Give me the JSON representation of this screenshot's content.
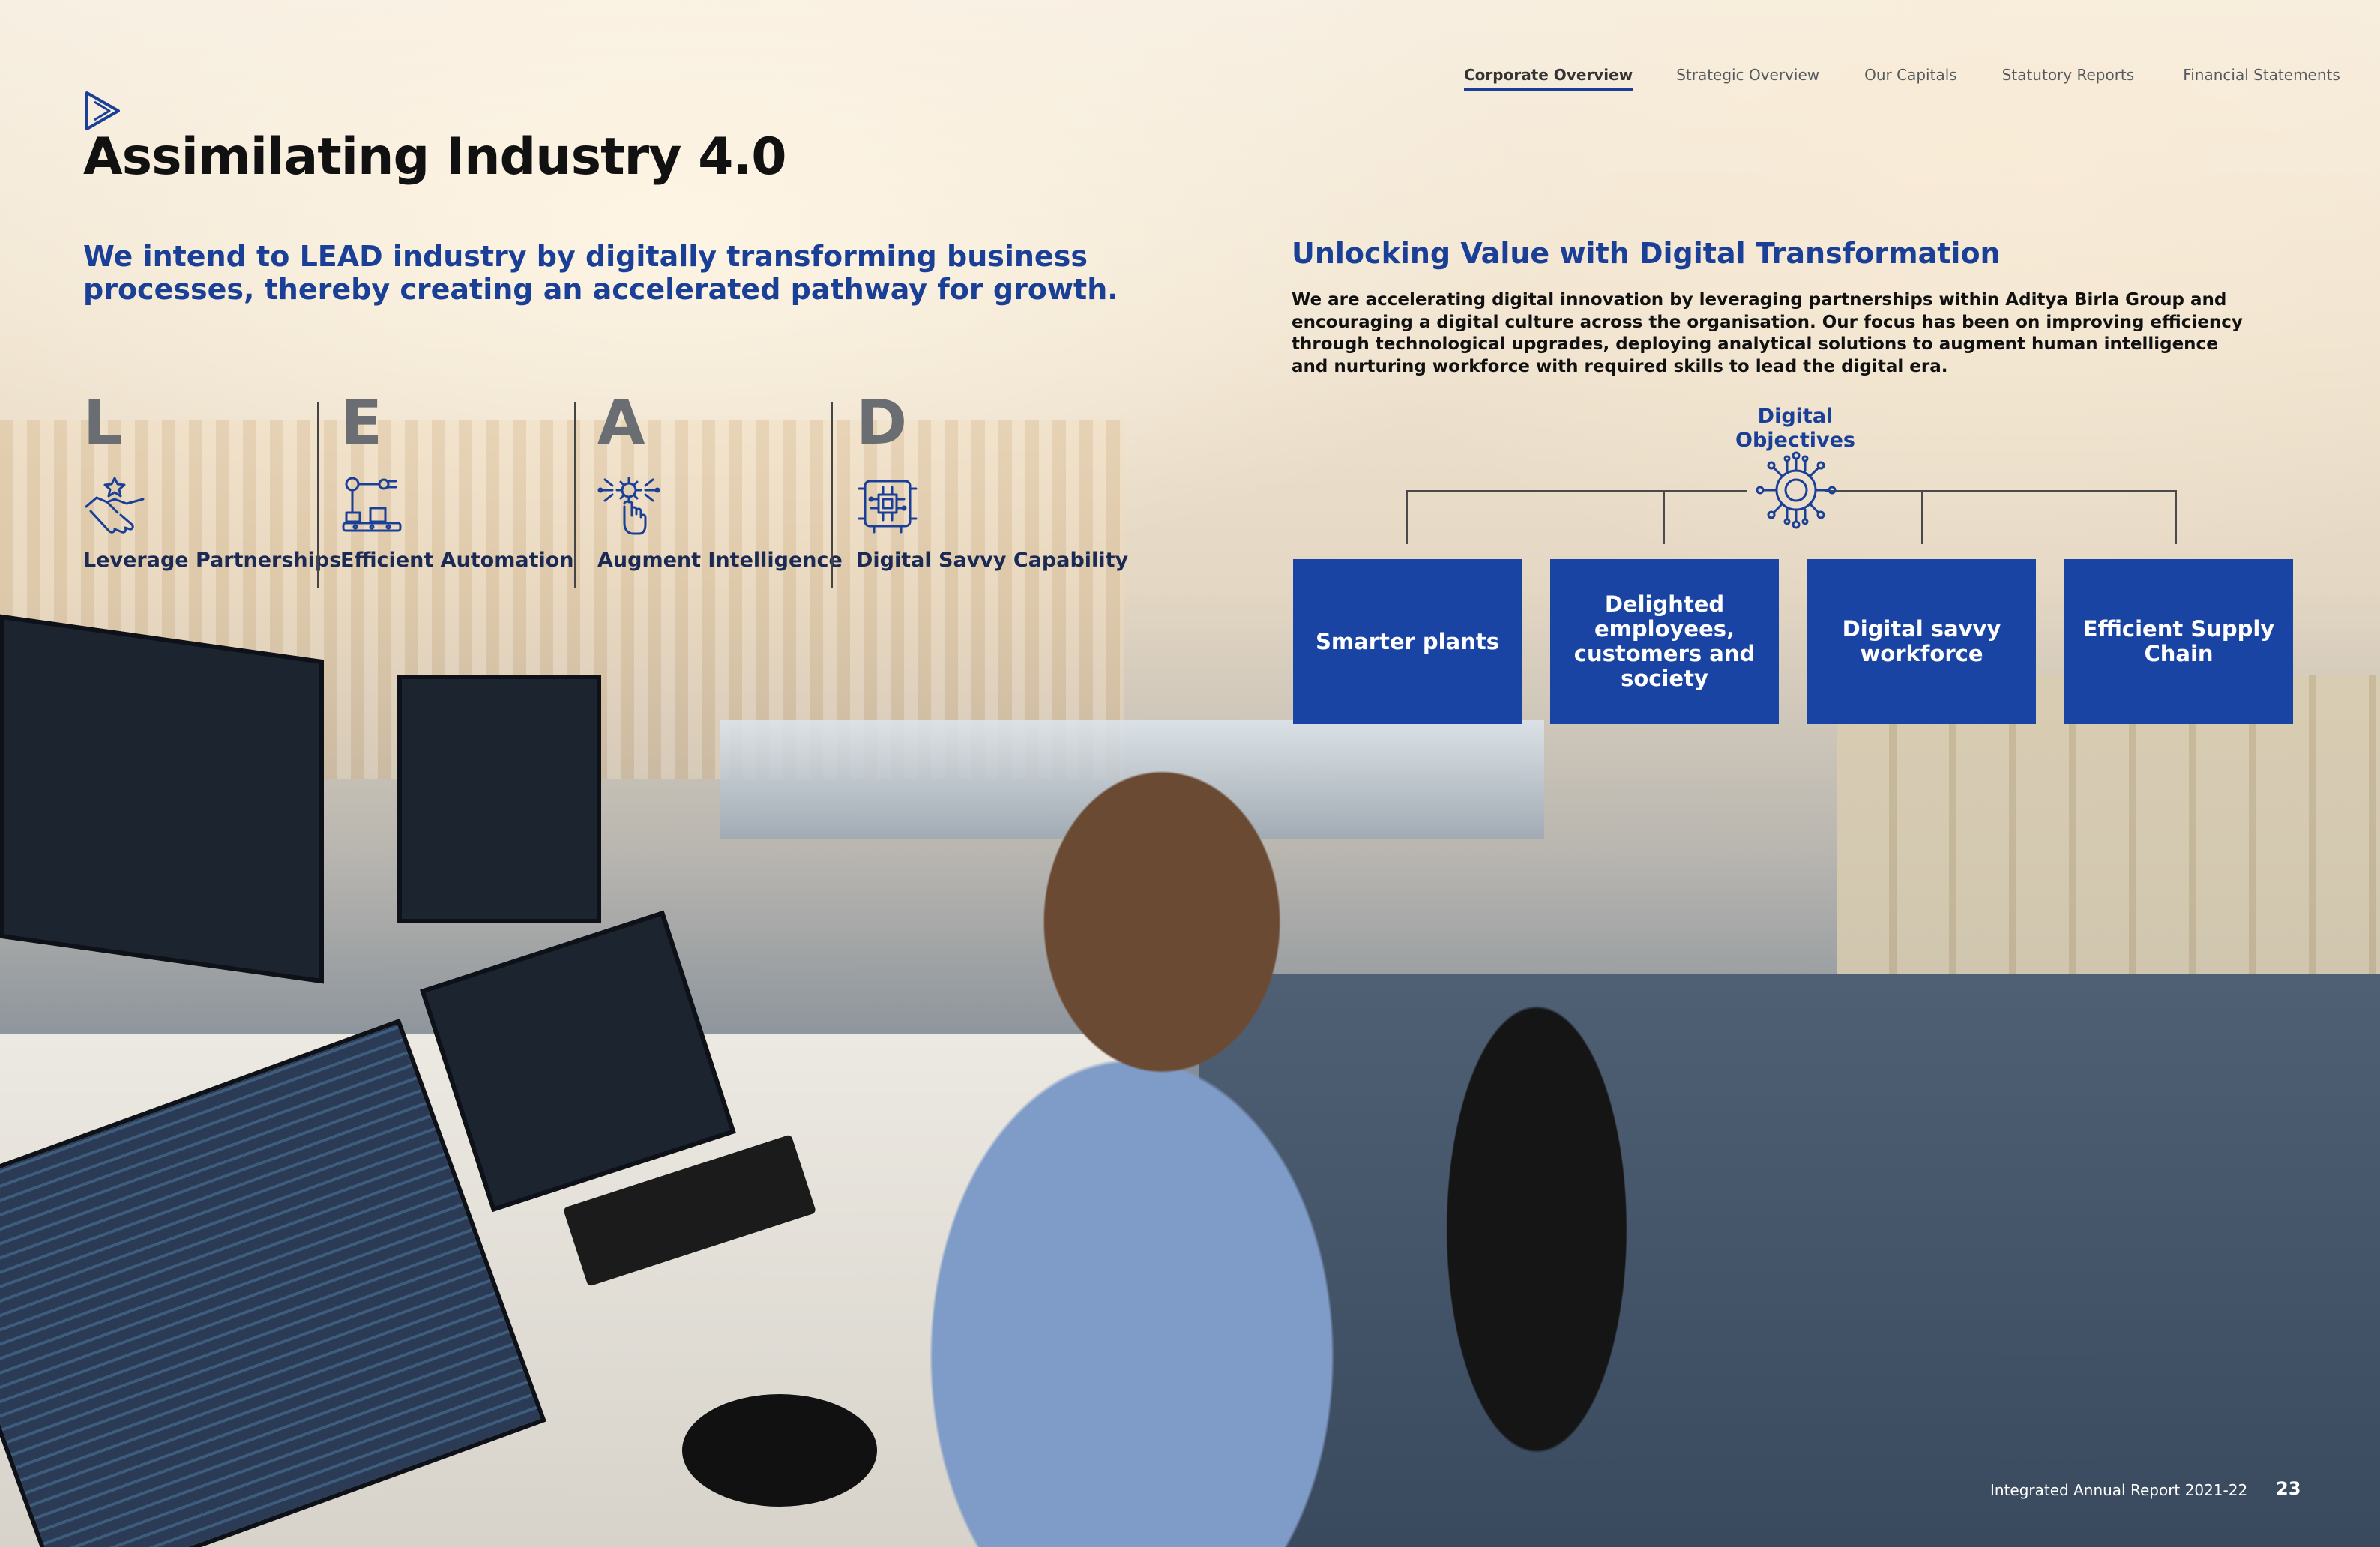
{
  "nav": {
    "items": [
      {
        "label": "Corporate Overview",
        "active": true
      },
      {
        "label": "Strategic Overview",
        "active": false
      },
      {
        "label": "Our Capitals",
        "active": false
      },
      {
        "label": "Statutory Reports",
        "active": false
      },
      {
        "label": "Financial Statements",
        "active": false
      }
    ]
  },
  "page_title": "Assimilating Industry 4.0",
  "intro": "We intend to LEAD industry by digitally transforming business processes, thereby creating an accelerated pathway for growth.",
  "lead": [
    {
      "letter": "L",
      "label": "Leverage Partnerships",
      "icon": "handshake-icon"
    },
    {
      "letter": "E",
      "label": "Efficient Automation",
      "icon": "robotic-arm-icon"
    },
    {
      "letter": "A",
      "label": "Augment Intelligence",
      "icon": "hand-gear-icon"
    },
    {
      "letter": "D",
      "label": "Digital Savvy Capability",
      "icon": "circuit-chip-icon"
    }
  ],
  "digital": {
    "title": "Unlocking Value with Digital Transformation",
    "body": "We are accelerating digital innovation by leveraging partnerships within Aditya Birla Group and encouraging a digital culture across the organisation. Our focus has been on improving efficiency through technological upgrades, deploying analytical solutions to augment human intelligence and nurturing workforce with required skills to lead the digital era.",
    "objectives_label": "Digital Objectives",
    "objectives_icon": "network-hub-icon",
    "objectives": [
      "Smarter plants",
      "Delighted employees, customers and society",
      "Digital savvy workforce",
      "Efficient Supply Chain"
    ]
  },
  "footer": {
    "report": "Integrated Annual Report 2021-22",
    "page": "23"
  },
  "colors": {
    "brand_blue": "#1a44a3",
    "heading_blue": "#1a3f96"
  }
}
